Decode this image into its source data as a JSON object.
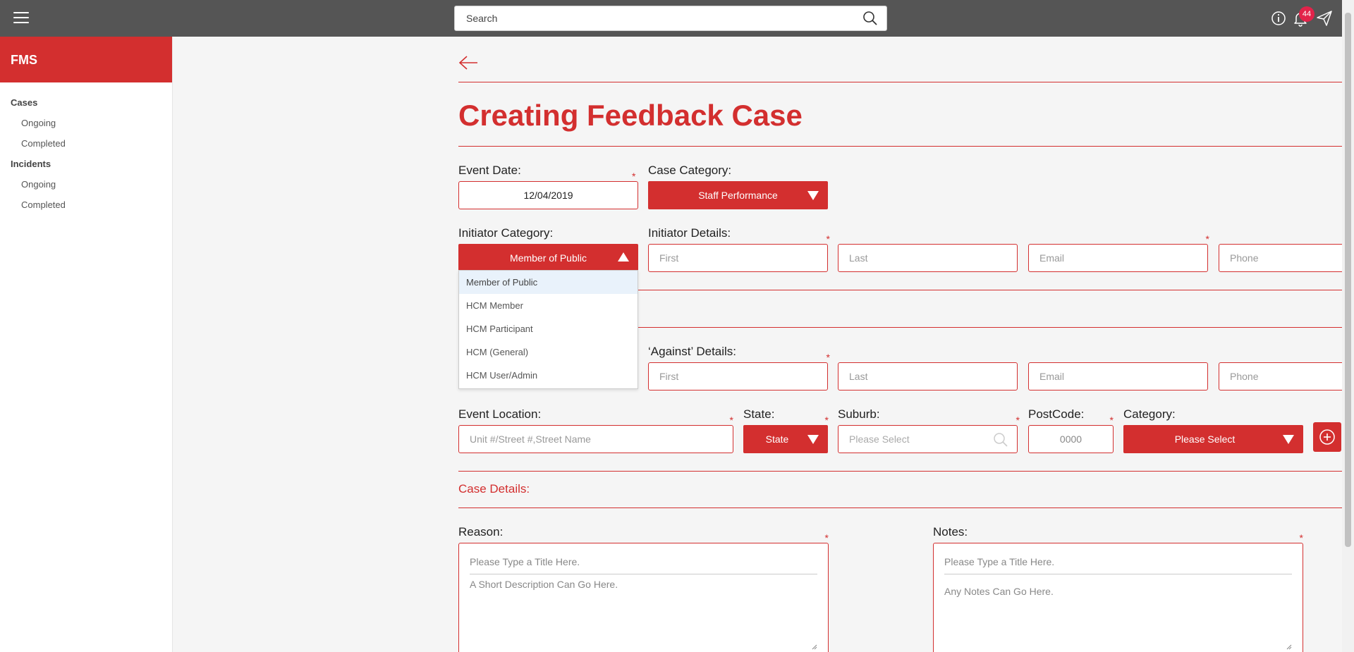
{
  "topbar": {
    "search_placeholder": "Search",
    "notification_count": "44"
  },
  "sidebar": {
    "brand": "FMS",
    "groups": [
      {
        "label": "Cases",
        "items": [
          "Ongoing",
          "Completed"
        ]
      },
      {
        "label": "Incidents",
        "items": [
          "Ongoing",
          "Completed"
        ]
      }
    ]
  },
  "page": {
    "title": "Creating Feedback Case"
  },
  "form": {
    "event_date_label": "Event Date:",
    "event_date_value": "12/04/2019",
    "case_category_label": "Case Category:",
    "case_category_value": "Staff Performance",
    "initiator_category_label": "Initiator Category:",
    "initiator_category_value": "Member of Public",
    "initiator_options": [
      "Member of Public",
      "HCM Member",
      "HCM Participant",
      "HCM (General)",
      "HCM User/Admin"
    ],
    "initiator_details_label": "Initiator Details:",
    "first_placeholder": "First",
    "last_placeholder": "Last",
    "email_placeholder": "Email",
    "phone_placeholder": "Phone",
    "against_details_label": "‘Against’ Details:",
    "event_location_label": "Event Location:",
    "event_location_placeholder": "Unit #/Street #,Street Name",
    "state_label": "State:",
    "state_value": "State",
    "suburb_label": "Suburb:",
    "suburb_placeholder": "Please Select",
    "postcode_label": "PostCode:",
    "postcode_placeholder": "0000",
    "category_label": "Category:",
    "category_value": "Please Select",
    "case_details_title": "Case Details:",
    "reason_label": "Reason:",
    "reason_title_placeholder": "Please Type a Title Here.",
    "reason_body_placeholder": "A Short Description Can Go Here.",
    "notes_label": "Notes:",
    "notes_title_placeholder": "Please Type a Title Here.",
    "notes_body_placeholder": "Any Notes Can Go Here.",
    "required_mark": "*"
  },
  "colors": {
    "brand": "#d32f2f",
    "topbar": "#555555",
    "badge": "#e2234a"
  }
}
